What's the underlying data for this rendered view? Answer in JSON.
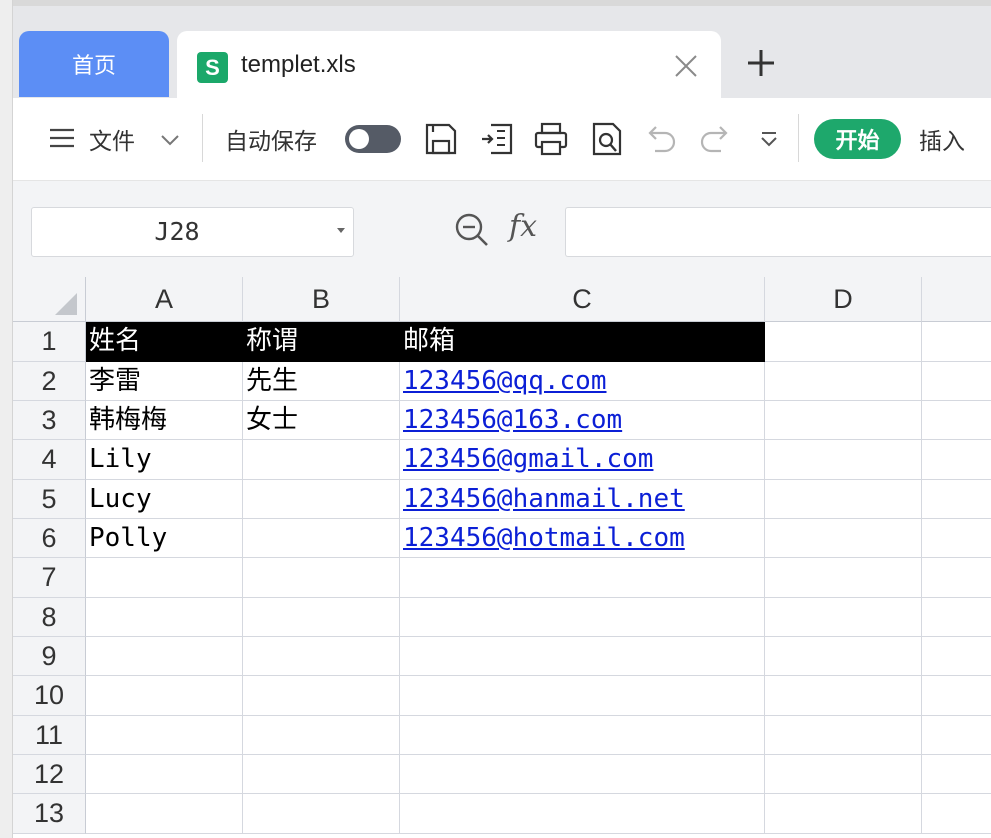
{
  "tabs": {
    "home_label": "首页",
    "doc_icon_letter": "S",
    "doc_title": "templet.xls"
  },
  "toolbar": {
    "file_label": "文件",
    "autosave_label": "自动保存",
    "start_label": "开始",
    "insert_label": "插入"
  },
  "formula_bar": {
    "cell_ref": "J28",
    "fx_label": "fx",
    "formula": ""
  },
  "sheet": {
    "columns": [
      "A",
      "B",
      "C",
      "D"
    ],
    "rows": [
      "1",
      "2",
      "3",
      "4",
      "5",
      "6",
      "7",
      "8",
      "9",
      "10",
      "11",
      "12",
      "13"
    ],
    "header_row": [
      "姓名",
      "称谓",
      "邮箱"
    ],
    "data": [
      {
        "name": "李雷",
        "title": "先生",
        "email": "123456@qq.com"
      },
      {
        "name": "韩梅梅",
        "title": "女士",
        "email": "123456@163.com"
      },
      {
        "name": "Lily",
        "title": "",
        "email": "123456@gmail.com"
      },
      {
        "name": "Lucy",
        "title": "",
        "email": "123456@hanmail.net"
      },
      {
        "name": "Polly",
        "title": "",
        "email": "123456@hotmail.com"
      }
    ]
  },
  "colors": {
    "home_tab": "#5c8ef5",
    "start_button": "#1ea86c",
    "file_icon": "#1ba86a",
    "link": "#0b1fd6",
    "header_fill": "#000000"
  }
}
